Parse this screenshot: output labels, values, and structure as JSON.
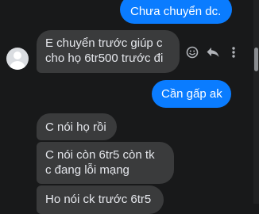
{
  "messages": [
    {
      "id": "m1",
      "direction": "out",
      "text": "Chưa chuyển dc."
    },
    {
      "id": "m2",
      "direction": "in",
      "lines": [
        "E chuyển trước giúp c",
        "cho họ 6tr500 trước đi"
      ]
    },
    {
      "id": "m3",
      "direction": "out",
      "text": "Cần gấp ak"
    },
    {
      "id": "m4",
      "direction": "in",
      "text": "C nói họ rồi"
    },
    {
      "id": "m5",
      "direction": "in",
      "lines": [
        "C nói còn 6tr5 còn tk",
        "c đang lỗi mạng"
      ]
    },
    {
      "id": "m6",
      "direction": "in",
      "text": "Ho nói ck trước 6tr5"
    }
  ],
  "icons": {
    "react": "smiley-icon",
    "reply": "reply-icon",
    "more": "more-vertical-icon",
    "avatar": "user-avatar-icon"
  },
  "colors": {
    "background": "#18191a",
    "outgoing_bubble": "#0a7cff",
    "incoming_bubble": "#3a3b3c",
    "text_incoming": "#e4e6eb",
    "text_outgoing": "#ffffff",
    "icon": "#b0b3b8"
  }
}
